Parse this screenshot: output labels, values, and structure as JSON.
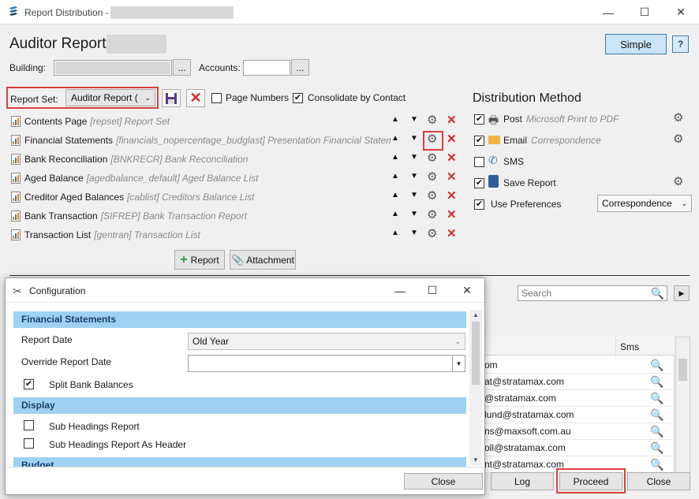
{
  "window": {
    "title": "Report Distribution -",
    "minimize": "—",
    "maximize": "☐",
    "close": "✕"
  },
  "header": {
    "title": "Auditor Report",
    "simple_label": "Simple",
    "help": "?"
  },
  "building": {
    "label": "Building:",
    "browse": "...",
    "accounts_label": "Accounts:",
    "accounts_browse": "..."
  },
  "reportset": {
    "label": "Report Set:",
    "value": "Auditor Report (",
    "save_icon": "save-icon",
    "delete_icon": "delete-icon"
  },
  "options": {
    "page_numbers": "Page Numbers",
    "consolidate": "Consolidate by Contact",
    "consolidate_checked": true
  },
  "reports": [
    {
      "name": "Contents Page",
      "code": "[repset] Report Set"
    },
    {
      "name": "Financial Statements",
      "code": "[financials_nopercentage_budglast] Presentation Financial Statem"
    },
    {
      "name": "Bank Reconciliation",
      "code": "[BNKRECR] Bank Reconciliation"
    },
    {
      "name": "Aged Balance",
      "code": "[agedbalance_default] Aged Balance List"
    },
    {
      "name": "Creditor Aged Balances",
      "code": "[cablist] Creditors Balance List"
    },
    {
      "name": "Bank Transaction",
      "code": "[SIFREP] Bank Transaction Report"
    },
    {
      "name": "Transaction List",
      "code": "[gentran] Transaction List"
    }
  ],
  "add_buttons": {
    "report": "Report",
    "attachment": "Attachment"
  },
  "distribution": {
    "title": "Distribution Method",
    "post_label": "Post",
    "post_detail": "Microsoft Print to PDF",
    "email_label": "Email",
    "email_detail": "Correspondence",
    "sms_label": "SMS",
    "save_label": "Save Report",
    "prefs_label": "Use Preferences",
    "prefs_value": "Correspondence"
  },
  "search": {
    "placeholder": "Search"
  },
  "contacts": {
    "sms_header": "Sms",
    "emails": [
      "om",
      "at@stratamax.com",
      "@stratamax.com",
      "lund@stratamax.com",
      "ns@maxsoft.com.au",
      "oll@stratamax.com",
      "nt@stratamax.com"
    ]
  },
  "footer": {
    "log": "Log",
    "proceed": "Proceed",
    "close": "Close"
  },
  "config": {
    "title": "Configuration",
    "section1": "Financial Statements",
    "report_date_label": "Report Date",
    "report_date_value": "Old Year",
    "override_label": "Override Report Date",
    "split_label": "Split Bank Balances",
    "section2": "Display",
    "sub_headings": "Sub Headings Report",
    "sub_headings_header": "Sub Headings Report As Header",
    "section3": "Budget",
    "close": "Close"
  }
}
